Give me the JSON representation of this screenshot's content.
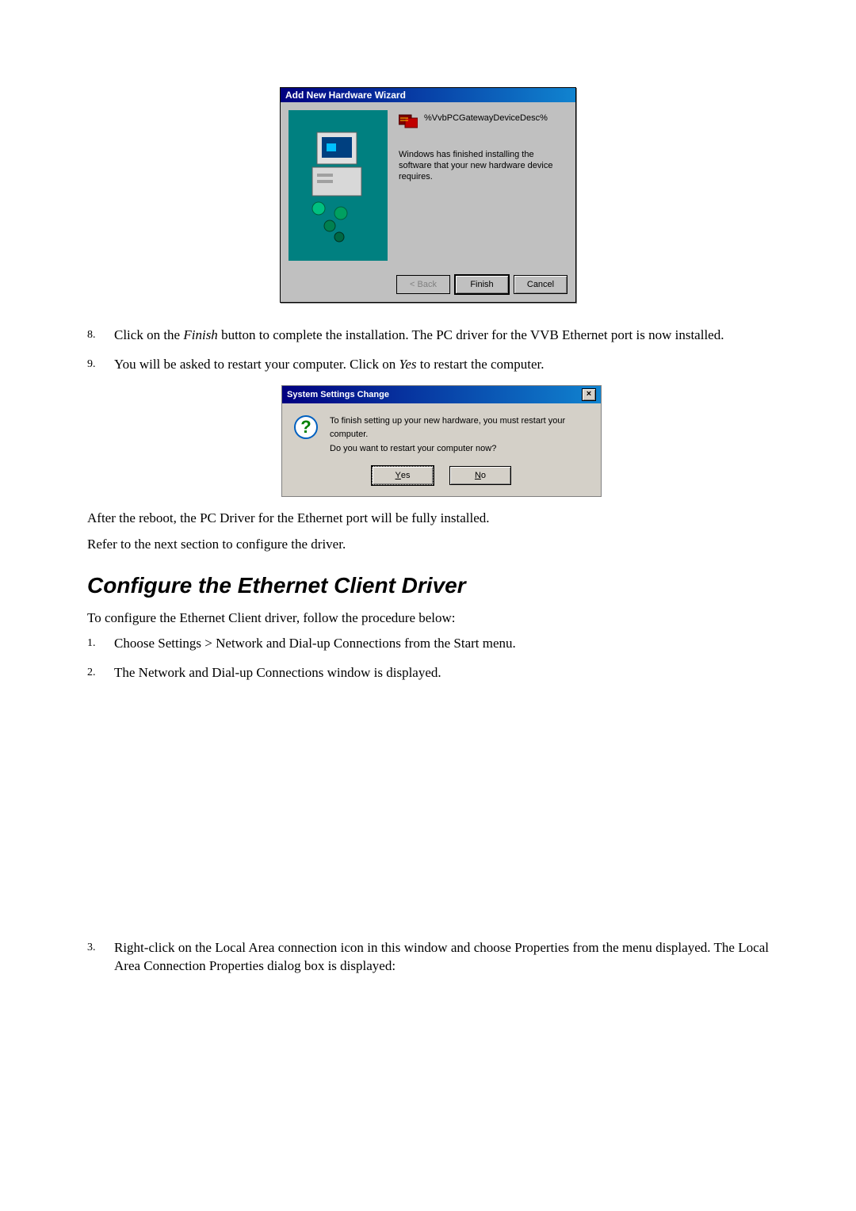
{
  "wizard": {
    "title": "Add New Hardware Wizard",
    "device_desc": "%VvbPCGatewayDeviceDesc%",
    "finished_text": "Windows has finished installing the software that your new hardware device requires.",
    "back_label": "< Back",
    "finish_label": "Finish",
    "cancel_label": "Cancel"
  },
  "steps_a": [
    {
      "num": "8.",
      "pre": "Click on the ",
      "italic": "Finish",
      "post": " button to complete the installation. The PC driver for the VVB Ethernet port is now installed."
    },
    {
      "num": "9.",
      "pre": "You will be asked to restart your computer. Click on ",
      "italic": "Yes",
      "post": " to restart the computer."
    }
  ],
  "sschange": {
    "title": "System Settings Change",
    "msg1": "To finish setting up your new hardware, you must restart your computer.",
    "msg2": "Do you want to restart your computer now?",
    "yes_prefix": "Y",
    "yes_rest": "es",
    "no_prefix": "N",
    "no_rest": "o",
    "close_glyph": "×"
  },
  "after1": "After the reboot, the PC Driver for the Ethernet port will be fully installed.",
  "after2": "Refer to the next section to configure the driver.",
  "section_title": "Configure the Ethernet Client Driver",
  "intro": "To configure the Ethernet Client driver, follow the procedure below:",
  "steps_b": [
    {
      "num": "1.",
      "text": "Choose Settings > Network and Dial-up Connections from the Start menu."
    },
    {
      "num": "2.",
      "text": "The Network and Dial-up Connections window is displayed."
    },
    {
      "num": "3.",
      "text": "Right-click on the Local Area connection icon in this window and choose Properties from the menu displayed. The Local Area Connection Properties dialog box is displayed:"
    }
  ]
}
